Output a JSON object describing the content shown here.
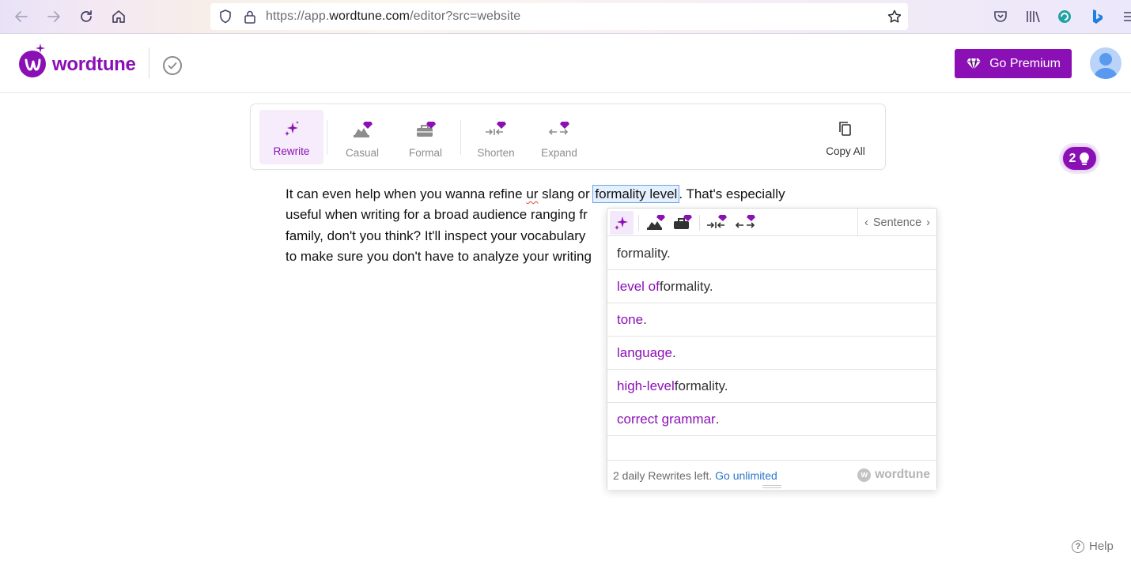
{
  "browser": {
    "url_prefix": "https://app.",
    "url_domain": "wordtune.com",
    "url_suffix": "/editor?src=website"
  },
  "app": {
    "logo_text": "wordtune",
    "premium_label": "Go Premium",
    "brand_color": "#8a10b5"
  },
  "toolbar": {
    "tools": [
      {
        "label": "Rewrite",
        "icon": "sparkles-icon",
        "active": true
      },
      {
        "label": "Casual",
        "icon": "casual-icon",
        "premium": true
      },
      {
        "label": "Formal",
        "icon": "briefcase-icon",
        "premium": true
      },
      {
        "label": "Shorten",
        "icon": "shorten-arrows-icon",
        "premium": true
      },
      {
        "label": "Expand",
        "icon": "expand-arrows-icon",
        "premium": true
      }
    ],
    "copy_label": "Copy All"
  },
  "hint_badge": {
    "count": "2"
  },
  "editor": {
    "line1_a": "It can even help when you wanna refine ",
    "line1_sq": "ur",
    "line1_b": " slang or ",
    "line1_hl": "formality level",
    "line1_c": ". That's especially",
    "line2": "useful when writing for a broad audience ranging fr",
    "line3": "family, don't you think? It'll inspect your vocabulary",
    "line4": "to make sure you don't have to analyze your writing"
  },
  "popup": {
    "mode_label": "Sentence",
    "suggestions": [
      {
        "purple": "",
        "rest": "formality."
      },
      {
        "purple": "level of",
        "rest": " formality."
      },
      {
        "purple": "tone",
        "rest": "."
      },
      {
        "purple": "language",
        "rest": "."
      },
      {
        "purple": "high-level",
        "rest": " formality."
      },
      {
        "purple": "correct grammar",
        "rest": "."
      }
    ],
    "footer_text": "2 daily Rewrites left.",
    "footer_link": "Go unlimited",
    "footer_brand": "wordtune"
  },
  "help_label": "Help"
}
